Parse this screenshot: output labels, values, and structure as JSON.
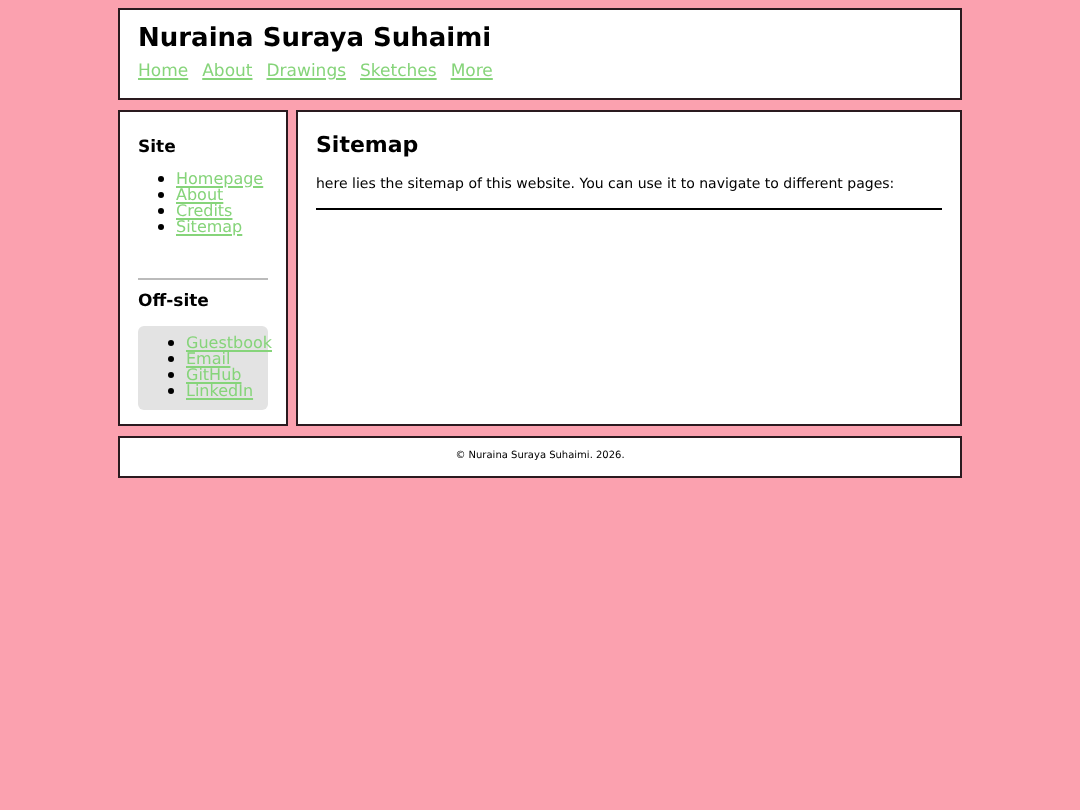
{
  "header": {
    "title": "Nuraina Suraya Suhaimi",
    "nav": [
      "Home",
      "About",
      "Drawings",
      "Sketches",
      "More"
    ]
  },
  "sidebar": {
    "sections": [
      {
        "kind": "plain",
        "heading": "Site",
        "links": [
          "Homepage",
          "About",
          "Credits",
          "Sitemap"
        ]
      },
      {
        "kind": "boxed",
        "heading": "Off-site",
        "links": [
          "Guestbook",
          "Email",
          "GitHub",
          "LinkedIn"
        ]
      }
    ]
  },
  "main": {
    "title": "Sitemap",
    "text": "here lies the sitemap of this website. You can use it to navigate to different pages:"
  },
  "footer": "© Nuraina Suraya Suhaimi. 2026."
}
